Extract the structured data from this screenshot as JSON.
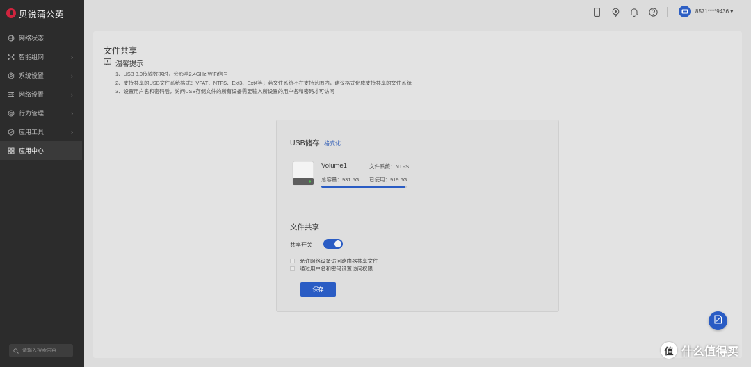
{
  "brand": {
    "name": "贝锐蒲公英",
    "color": "#d0243e"
  },
  "sidebar": {
    "items": [
      {
        "label": "网络状态",
        "icon": "globe-icon",
        "has_chevron": false
      },
      {
        "label": "智能组网",
        "icon": "network-icon",
        "has_chevron": true
      },
      {
        "label": "系统设置",
        "icon": "gear-icon",
        "has_chevron": true
      },
      {
        "label": "网络设置",
        "icon": "sliders-icon",
        "has_chevron": true
      },
      {
        "label": "行为管理",
        "icon": "behavior-icon",
        "has_chevron": true
      },
      {
        "label": "应用工具",
        "icon": "shield-icon",
        "has_chevron": true
      },
      {
        "label": "应用中心",
        "icon": "apps-icon",
        "has_chevron": false,
        "active": true
      }
    ],
    "search_placeholder": "请输入搜索内容"
  },
  "topbar": {
    "icons": [
      "phone-icon",
      "location-icon",
      "bell-icon",
      "help-icon"
    ],
    "username": "8571****9436 ▾"
  },
  "main": {
    "title": "文件共享",
    "tip_title": "温馨提示",
    "tips": [
      "1、USB 3.0传输数据时，会影响2.4GHz WiFi信号",
      "2、支持共享的USB文件系统格式：VFAT、NTFS、Ext3、Ext4等；若文件系统不在支持范围内，建议格式化成支持共享的文件系统",
      "3、设置用户名和密码后，访问USB存储文件的所有设备需要输入所设置的用户名和密码才可访问"
    ]
  },
  "usb": {
    "title": "USB储存",
    "format_label": "格式化",
    "volume_name": "Volume1",
    "filesystem": "文件系统：NTFS",
    "total": "总容量：931.5G",
    "used": "已使用：919.6G",
    "used_fraction": 0.987
  },
  "share": {
    "title": "文件共享",
    "toggle_label": "共享开关",
    "toggle_on": true,
    "options": [
      "允许网络设备访问路由器共享文件",
      "通过用户名和密码设置访问权限"
    ],
    "save_label": "保存"
  },
  "colors": {
    "accent": "#2a5cc4",
    "sidebar_bg": "#2c2c2c"
  },
  "watermark": {
    "text": "什么值得买",
    "logo": "值"
  }
}
